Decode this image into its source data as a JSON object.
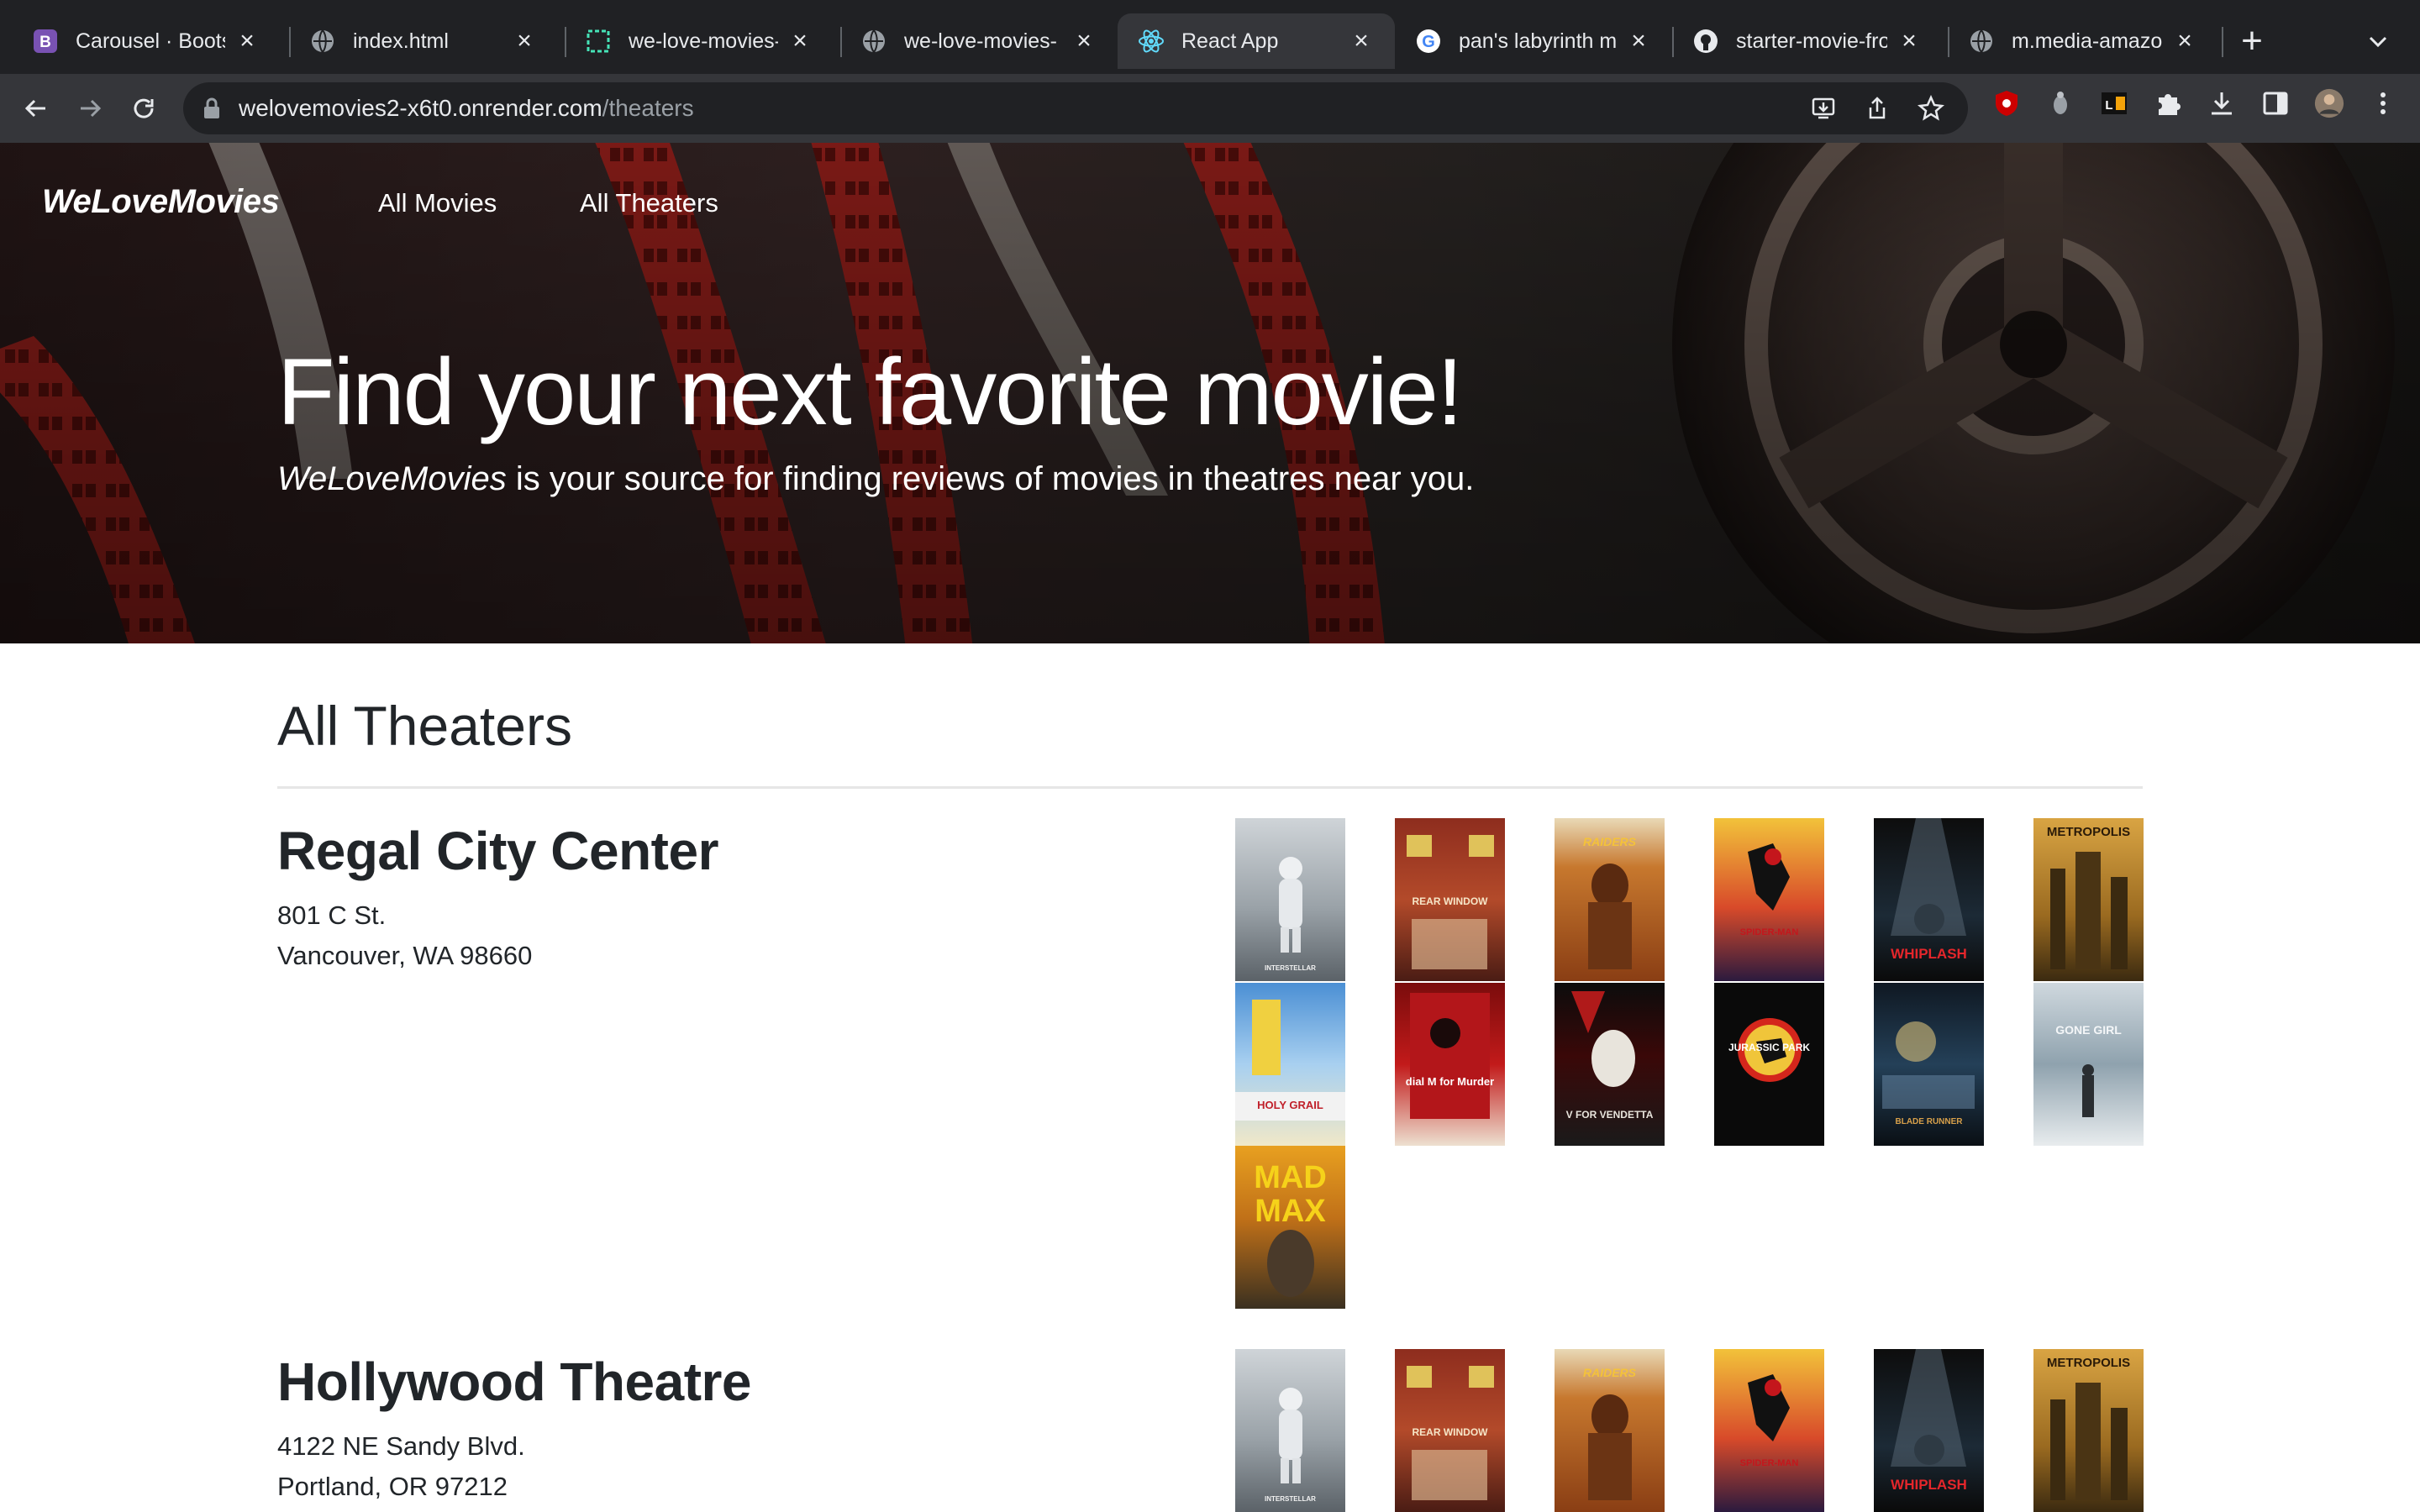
{
  "browser": {
    "tabs": [
      {
        "label": "Carousel · Bootst",
        "icon": "bootstrap-icon"
      },
      {
        "label": "index.html",
        "icon": "globe-icon"
      },
      {
        "label": "we-love-movies-",
        "icon": "render-icon"
      },
      {
        "label": "we-love-movies-",
        "icon": "globe-icon"
      },
      {
        "label": "React App",
        "icon": "react-icon",
        "active": true
      },
      {
        "label": "pan's labyrinth m",
        "icon": "google-icon"
      },
      {
        "label": "starter-movie-fro",
        "icon": "github-icon"
      },
      {
        "label": "m.media-amazon",
        "icon": "globe-icon"
      }
    ],
    "url_host": "welovemovies2-x6t0.onrender.com",
    "url_path": "/theaters"
  },
  "site": {
    "brand": "WeLoveMovies",
    "nav": [
      "All Movies",
      "All Theaters"
    ],
    "hero_title": "Find your next favorite movie!",
    "hero_sub_brand": "WeLoveMovies",
    "hero_sub_rest": " is your source for finding reviews of movies in theatres near you."
  },
  "page": {
    "title": "All Theaters"
  },
  "theaters": [
    {
      "name": "Regal City Center",
      "address_line1": "801 C St.",
      "address_line2": "Vancouver, WA 98660"
    },
    {
      "name": "Hollywood Theatre",
      "address_line1": "4122 NE Sandy Blvd.",
      "address_line2": "Portland, OR 97212"
    }
  ],
  "posters": {
    "interstellar": "INTERSTELLAR",
    "rear_window": "REAR WINDOW",
    "raiders": "RAIDERS",
    "spiderverse": "SPIDER-MAN",
    "whiplash": "WHIPLASH",
    "metropolis": "METROPOLIS",
    "holy_grail": "HOLY GRAIL",
    "dial_m": "dial M for Murder",
    "vendetta": "V FOR VENDETTA",
    "jurassic": "JURASSIC PARK",
    "blade_runner": "BLADE RUNNER",
    "gone_girl": "GONE GIRL",
    "mad_max": "MAD MAX"
  }
}
